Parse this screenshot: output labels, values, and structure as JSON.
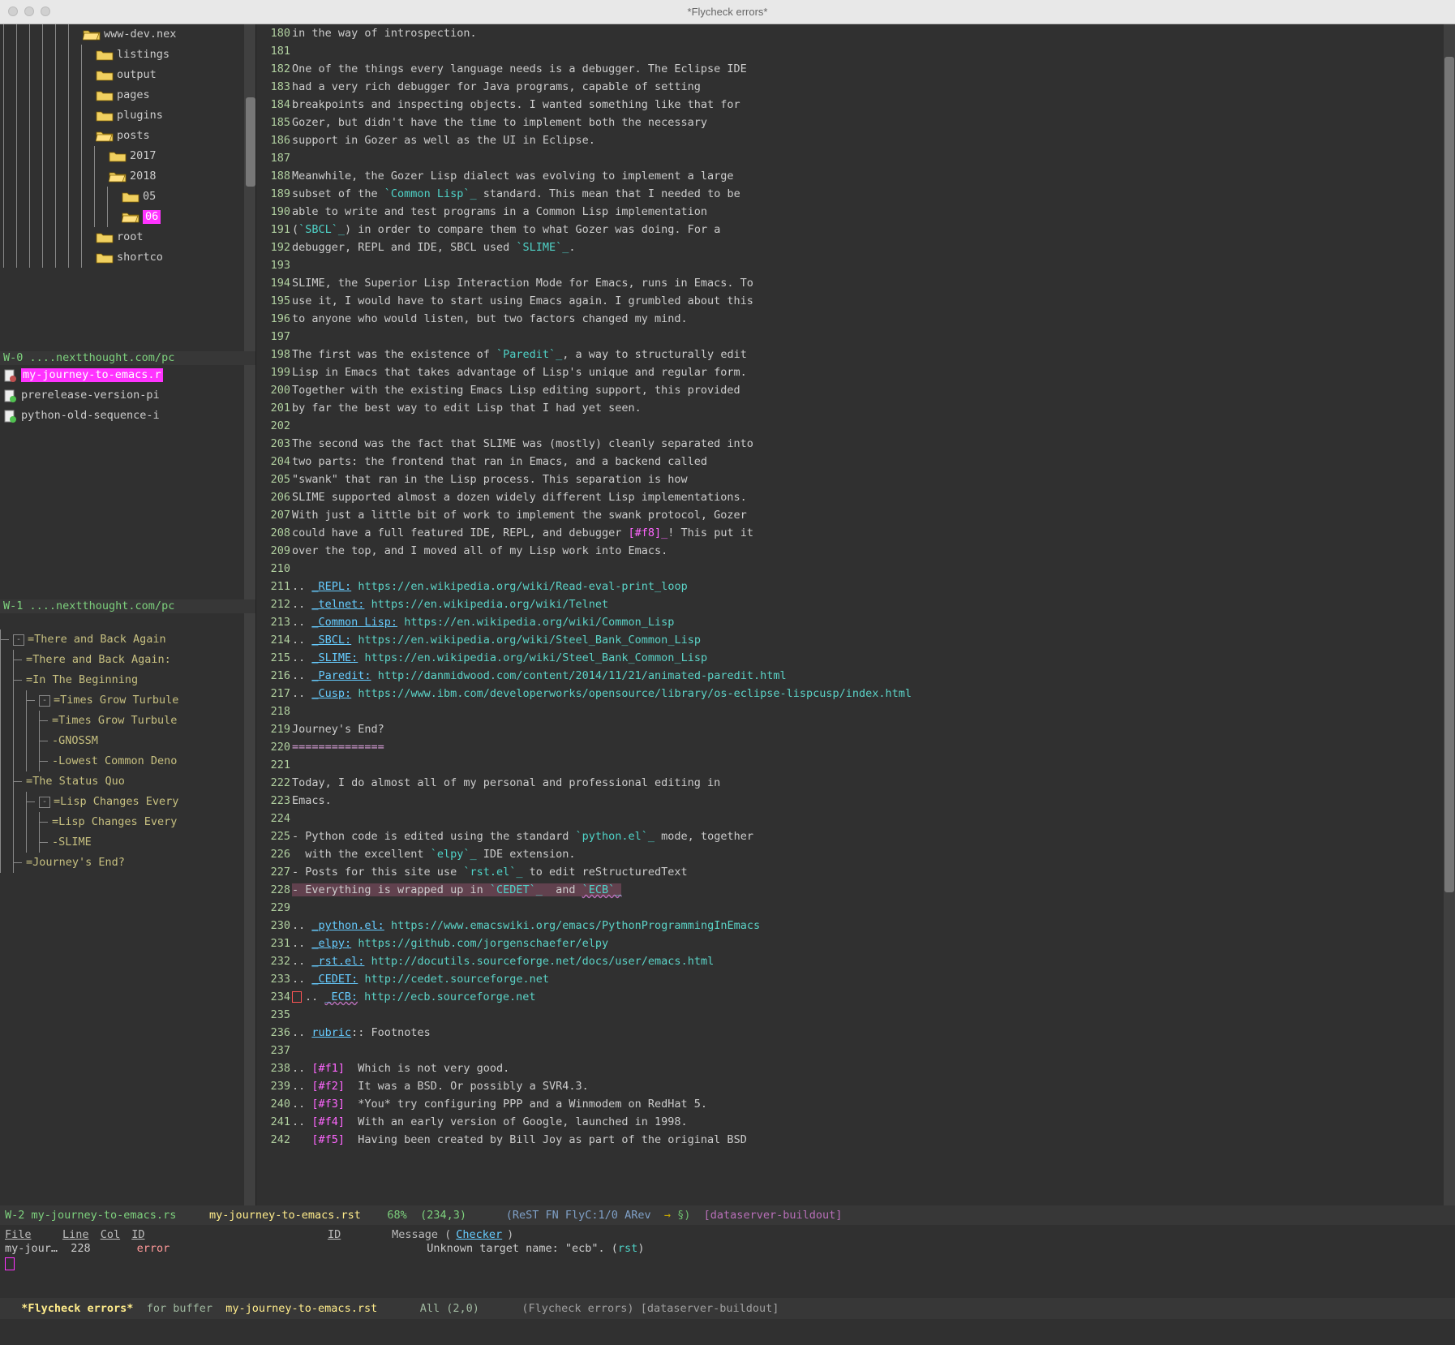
{
  "window": {
    "title": "*Flycheck errors*"
  },
  "ecb": {
    "dirs": {
      "status": "W-0 ....nextthought.com/pc",
      "items": [
        {
          "depth": 6,
          "open": true,
          "name": "www-dev.nex",
          "current": false
        },
        {
          "depth": 7,
          "open": false,
          "name": "listings",
          "current": false
        },
        {
          "depth": 7,
          "open": false,
          "name": "output",
          "current": false
        },
        {
          "depth": 7,
          "open": false,
          "name": "pages",
          "current": false
        },
        {
          "depth": 7,
          "open": false,
          "name": "plugins",
          "current": false
        },
        {
          "depth": 7,
          "open": true,
          "name": "posts",
          "current": false
        },
        {
          "depth": 8,
          "open": false,
          "name": "2017",
          "current": false
        },
        {
          "depth": 8,
          "open": true,
          "name": "2018",
          "current": false
        },
        {
          "depth": 9,
          "open": false,
          "name": "05",
          "current": false
        },
        {
          "depth": 9,
          "open": true,
          "name": "06",
          "current": true
        },
        {
          "depth": 7,
          "open": false,
          "name": "root",
          "current": false
        },
        {
          "depth": 7,
          "open": false,
          "name": "shortco",
          "current": false
        }
      ]
    },
    "sources": {
      "status": "W-1 ....nextthought.com/pc",
      "items": [
        {
          "icon": "dirty",
          "name": "my-journey-to-emacs.r",
          "selected": true
        },
        {
          "icon": "ok",
          "name": "prerelease-version-pi",
          "selected": false
        },
        {
          "icon": "ok",
          "name": "python-old-sequence-i",
          "selected": false
        }
      ]
    },
    "outline": {
      "items": [
        {
          "depth": 0,
          "toggle": "-",
          "name": "=There and Back Again"
        },
        {
          "depth": 1,
          "toggle": "",
          "name": "=There and Back Again:"
        },
        {
          "depth": 1,
          "toggle": "",
          "name": "=In The Beginning"
        },
        {
          "depth": 2,
          "toggle": "-",
          "name": "=Times Grow Turbule"
        },
        {
          "depth": 3,
          "toggle": "",
          "name": "=Times Grow Turbule"
        },
        {
          "depth": 3,
          "toggle": "",
          "name": "-GNOSSM"
        },
        {
          "depth": 3,
          "toggle": "",
          "name": "-Lowest Common Deno"
        },
        {
          "depth": 1,
          "toggle": "",
          "name": "=The Status Quo"
        },
        {
          "depth": 2,
          "toggle": "-",
          "name": "=Lisp Changes Every"
        },
        {
          "depth": 3,
          "toggle": "",
          "name": "=Lisp Changes Every"
        },
        {
          "depth": 3,
          "toggle": "",
          "name": "-SLIME"
        },
        {
          "depth": 1,
          "toggle": "",
          "name": "=Journey's End?"
        }
      ]
    }
  },
  "editor": {
    "first_line": 180,
    "lines": [
      {
        "t": "in the way of introspection."
      },
      {
        "t": ""
      },
      {
        "t": "One of the things every language needs is a debugger. The Eclipse IDE"
      },
      {
        "t": "had a very rich debugger for Java programs, capable of setting"
      },
      {
        "t": "breakpoints and inspecting objects. I wanted something like that for"
      },
      {
        "t": "Gozer, but didn't have the time to implement both the necessary"
      },
      {
        "t": "support in Gozer as well as the UI in Eclipse."
      },
      {
        "t": ""
      },
      {
        "t": "Meanwhile, the Gozer Lisp dialect was evolving to implement a large"
      },
      {
        "seg": [
          {
            "t": "subset of the "
          },
          {
            "t": "`Common Lisp`_",
            "c": "c-str"
          },
          {
            "t": " standard. This mean that I needed to be"
          }
        ]
      },
      {
        "t": "able to write and test programs in a Common Lisp implementation"
      },
      {
        "seg": [
          {
            "t": "("
          },
          {
            "t": "`SBCL`_",
            "c": "c-str"
          },
          {
            "t": ") in order to compare them to what Gozer was doing. For a"
          }
        ]
      },
      {
        "seg": [
          {
            "t": "debugger, REPL and IDE, SBCL used "
          },
          {
            "t": "`SLIME`_",
            "c": "c-str"
          },
          {
            "t": "."
          }
        ]
      },
      {
        "t": ""
      },
      {
        "t": "SLIME, the Superior Lisp Interaction Mode for Emacs, runs in Emacs. To"
      },
      {
        "t": "use it, I would have to start using Emacs again. I grumbled about this"
      },
      {
        "t": "to anyone who would listen, but two factors changed my mind."
      },
      {
        "t": ""
      },
      {
        "seg": [
          {
            "t": "The first was the existence of "
          },
          {
            "t": "`Paredit`_",
            "c": "c-str"
          },
          {
            "t": ", a way to structurally edit"
          }
        ]
      },
      {
        "t": "Lisp in Emacs that takes advantage of Lisp's unique and regular form."
      },
      {
        "t": "Together with the existing Emacs Lisp editing support, this provided"
      },
      {
        "t": "by far the best way to edit Lisp that I had yet seen."
      },
      {
        "t": ""
      },
      {
        "t": "The second was the fact that SLIME was (mostly) cleanly separated into"
      },
      {
        "t": "two parts: the frontend that ran in Emacs, and a backend called"
      },
      {
        "t": "\"swank\" that ran in the Lisp process. This separation is how"
      },
      {
        "t": "SLIME supported almost a dozen widely different Lisp implementations."
      },
      {
        "t": "With just a little bit of work to implement the swank protocol, Gozer"
      },
      {
        "seg": [
          {
            "t": "could have a full featured IDE, REPL, and debugger "
          },
          {
            "t": "[#f8]_",
            "c": "c-foot"
          },
          {
            "t": "! This put it"
          }
        ]
      },
      {
        "t": "over the top, and I moved all of my Lisp work into Emacs."
      },
      {
        "t": ""
      },
      {
        "seg": [
          {
            "t": ".. "
          },
          {
            "t": "_REPL:",
            "c": "c-kw"
          },
          {
            "t": " "
          },
          {
            "t": "https://en.wikipedia.org/wiki/Read-eval-print_loop",
            "c": "c-cite"
          }
        ]
      },
      {
        "seg": [
          {
            "t": ".. "
          },
          {
            "t": "_telnet:",
            "c": "c-kw"
          },
          {
            "t": " "
          },
          {
            "t": "https://en.wikipedia.org/wiki/Telnet",
            "c": "c-cite"
          }
        ]
      },
      {
        "seg": [
          {
            "t": ".. "
          },
          {
            "t": "_Common Lisp:",
            "c": "c-kw"
          },
          {
            "t": " "
          },
          {
            "t": "https://en.wikipedia.org/wiki/Common_Lisp",
            "c": "c-cite"
          }
        ]
      },
      {
        "seg": [
          {
            "t": ".. "
          },
          {
            "t": "_SBCL:",
            "c": "c-kw"
          },
          {
            "t": " "
          },
          {
            "t": "https://en.wikipedia.org/wiki/Steel_Bank_Common_Lisp",
            "c": "c-cite"
          }
        ]
      },
      {
        "seg": [
          {
            "t": ".. "
          },
          {
            "t": "_SLIME:",
            "c": "c-kw"
          },
          {
            "t": " "
          },
          {
            "t": "https://en.wikipedia.org/wiki/Steel_Bank_Common_Lisp",
            "c": "c-cite"
          }
        ]
      },
      {
        "seg": [
          {
            "t": ".. "
          },
          {
            "t": "_Paredit:",
            "c": "c-kw"
          },
          {
            "t": " "
          },
          {
            "t": "http://danmidwood.com/content/2014/11/21/animated-paredit.html",
            "c": "c-cite"
          }
        ]
      },
      {
        "seg": [
          {
            "t": ".. "
          },
          {
            "t": "_Cusp:",
            "c": "c-kw"
          },
          {
            "t": " "
          },
          {
            "t": "https://www.ibm.com/developerworks/opensource/library/os-eclipse-lispcusp/index.html",
            "c": "c-cite"
          }
        ]
      },
      {
        "t": ""
      },
      {
        "t": "Journey's End?"
      },
      {
        "seg": [
          {
            "t": "==============",
            "c": "hr"
          }
        ]
      },
      {
        "t": ""
      },
      {
        "t": "Today, I do almost all of my personal and professional editing in"
      },
      {
        "t": "Emacs."
      },
      {
        "t": ""
      },
      {
        "seg": [
          {
            "t": "- Python code is edited using the standard "
          },
          {
            "t": "`python.el`_",
            "c": "c-str"
          },
          {
            "t": " mode, together"
          }
        ]
      },
      {
        "seg": [
          {
            "t": "  with the excellent "
          },
          {
            "t": "`elpy`_",
            "c": "c-str"
          },
          {
            "t": " IDE extension."
          }
        ]
      },
      {
        "seg": [
          {
            "t": "- Posts for this site use "
          },
          {
            "t": "`rst.el`_",
            "c": "c-str"
          },
          {
            "t": " to edit reStructuredText"
          }
        ]
      },
      {
        "seg": [
          {
            "t": "- Everything is wrapped up in ",
            "c": "c-hl"
          },
          {
            "t": "`CEDET`_",
            "c": "c-str c-hl"
          },
          {
            "t": "  and ",
            "c": "c-hl"
          },
          {
            "t": "`ECB`_",
            "c": "c-str c-hl c-under"
          }
        ]
      },
      {
        "t": ""
      },
      {
        "seg": [
          {
            "t": ".. "
          },
          {
            "t": "_python.el:",
            "c": "c-kw"
          },
          {
            "t": " "
          },
          {
            "t": "https://www.emacswiki.org/emacs/PythonProgrammingInEmacs",
            "c": "c-cite"
          }
        ]
      },
      {
        "seg": [
          {
            "t": ".. "
          },
          {
            "t": "_elpy:",
            "c": "c-kw"
          },
          {
            "t": " "
          },
          {
            "t": "https://github.com/jorgenschaefer/elpy",
            "c": "c-cite"
          }
        ]
      },
      {
        "seg": [
          {
            "t": ".. "
          },
          {
            "t": "_rst.el:",
            "c": "c-kw"
          },
          {
            "t": " "
          },
          {
            "t": "http://docutils.sourceforge.net/docs/user/emacs.html",
            "c": "c-cite"
          }
        ]
      },
      {
        "seg": [
          {
            "t": ".. "
          },
          {
            "t": "_CEDET:",
            "c": "c-kw"
          },
          {
            "t": " "
          },
          {
            "t": "http://cedet.sourceforge.net",
            "c": "c-cite"
          }
        ]
      },
      {
        "seg": [
          {
            "t": ".. ",
            "marker": true
          },
          {
            "t": "_ECB:",
            "c": "c-kw c-under"
          },
          {
            "t": " "
          },
          {
            "t": "http://ecb.sourceforge.net",
            "c": "c-cite"
          }
        ]
      },
      {
        "t": ""
      },
      {
        "seg": [
          {
            "t": ".. "
          },
          {
            "t": "rubric",
            "c": "c-kw"
          },
          {
            "t": ":: Footnotes"
          }
        ]
      },
      {
        "t": ""
      },
      {
        "seg": [
          {
            "t": ".. "
          },
          {
            "t": "[#f1]",
            "c": "c-foot"
          },
          {
            "t": "  Which is not very good."
          }
        ]
      },
      {
        "seg": [
          {
            "t": ".. "
          },
          {
            "t": "[#f2]",
            "c": "c-foot"
          },
          {
            "t": "  It was a BSD. Or possibly a SVR4.3."
          }
        ]
      },
      {
        "seg": [
          {
            "t": ".. "
          },
          {
            "t": "[#f3]",
            "c": "c-foot"
          },
          {
            "t": "  *You* try configuring PPP and a Winmodem on RedHat 5."
          }
        ]
      },
      {
        "seg": [
          {
            "t": ".. "
          },
          {
            "t": "[#f4]",
            "c": "c-foot"
          },
          {
            "t": "  With an early version of Google, launched in 1998."
          }
        ]
      },
      {
        "seg": [
          {
            "t": "   ",
            "c": ""
          },
          {
            "t": "[#f5]",
            "c": "c-foot"
          },
          {
            "t": "  Having been created by Bill Joy as part of the original BSD"
          }
        ]
      }
    ]
  },
  "modeline_editor": {
    "left": "W-2 my-journey-to-emacs.rs",
    "file": "my-journey-to-emacs.rst",
    "pct": "68%",
    "pos": "(234,3)",
    "modes": "(ReST FN FlyC:1/0 ARev",
    "arrow": "→",
    "sym": "§)",
    "venv": "[dataserver-buildout]"
  },
  "flycheck": {
    "headers": [
      "File",
      "Line",
      "Col",
      "ID",
      "ID",
      "Message (",
      "Checker",
      ")"
    ],
    "row": {
      "file": "my-jour…",
      "line": "228",
      "col": "",
      "level": "error",
      "msg": "Unknown target name: \"ecb\". (",
      "checker": "rst",
      "close": ")"
    }
  },
  "bottom": {
    "buffer": "*Flycheck errors*",
    "for": "for buffer",
    "file": "my-journey-to-emacs.rst",
    "pos": "All (2,0)",
    "modes": "(Flycheck errors) [dataserver-buildout]"
  }
}
